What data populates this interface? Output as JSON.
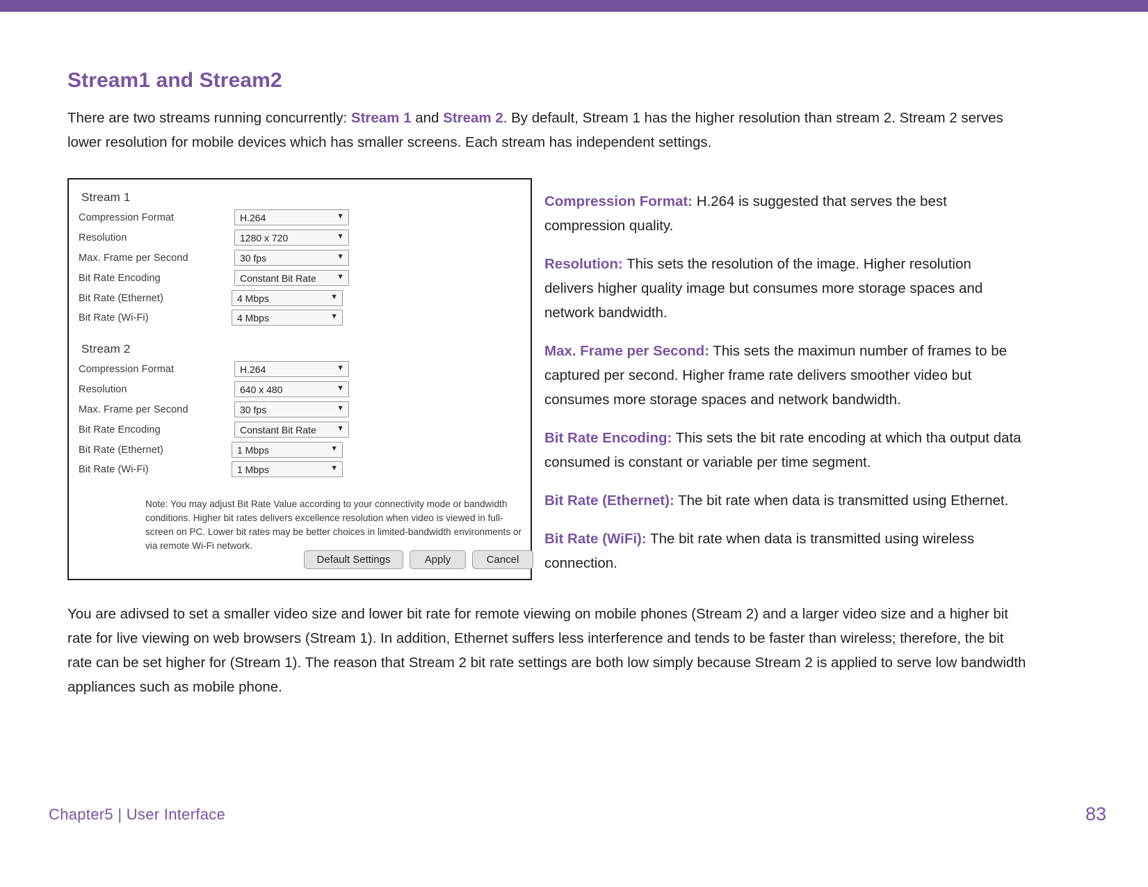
{
  "theme": {
    "accent": "#7a54a0",
    "top_bar": "#74529b",
    "body_text": "#231f20"
  },
  "section": {
    "title": "Stream1 and Stream2",
    "intro_part1": "There are two streams running concurrently: ",
    "intro_accent1": "Stream 1",
    "intro_part2": " and ",
    "intro_accent2": "Stream 2",
    "intro_part3": ". By default, Stream 1 has the higher resolution than stream 2. Stream 2 serves lower resolution for mobile devices which has smaller screens. Each stream has independent settings."
  },
  "settings_panel": {
    "stream1": {
      "heading": "Stream 1",
      "rows": [
        {
          "label": "Compression Format",
          "value": "H.264"
        },
        {
          "label": "Resolution",
          "value": "1280 x 720"
        },
        {
          "label": "Max. Frame per Second",
          "value": "30 fps"
        },
        {
          "label": "Bit Rate Encoding",
          "value": "Constant Bit Rate"
        },
        {
          "label": "Bit Rate (Ethernet)",
          "value": "4 Mbps"
        },
        {
          "label": "Bit Rate (Wi-Fi)",
          "value": "4 Mbps"
        }
      ]
    },
    "stream2": {
      "heading": "Stream 2",
      "rows": [
        {
          "label": "Compression Format",
          "value": "H.264"
        },
        {
          "label": "Resolution",
          "value": "640 x 480"
        },
        {
          "label": "Max. Frame per Second",
          "value": "30 fps"
        },
        {
          "label": "Bit Rate Encoding",
          "value": "Constant Bit Rate"
        },
        {
          "label": "Bit Rate (Ethernet)",
          "value": "1 Mbps"
        },
        {
          "label": "Bit Rate (Wi-Fi)",
          "value": "1 Mbps"
        }
      ]
    },
    "note": "Note: You may adjust Bit Rate Value according to your connectivity mode or bandwidth conditions. Higher bit rates delivers excellence resolution when video is viewed in full-screen on PC. Lower bit rates may be better choices in limited-bandwidth environments or via remote Wi-Fi network.",
    "buttons": {
      "default_settings": "Default Settings",
      "apply": "Apply",
      "cancel": "Cancel"
    },
    "dropdown_arrow_glyph": "▼"
  },
  "definitions": [
    {
      "term": "Compression Format:",
      "text": " H.264 is suggested that serves the best compression quality."
    },
    {
      "term": "Resolution:",
      "text": " This sets the resolution of the image. Higher resolution delivers higher quality image but consumes more storage spaces and network bandwidth."
    },
    {
      "term": "Max. Frame per Second:",
      "text": " This sets the maximun number of frames to be captured per second. Higher frame rate delivers smoother video but consumes more storage spaces and network bandwidth."
    },
    {
      "term": "Bit Rate Encoding:",
      "text": " This sets the bit rate encoding at which tha output data consumed is constant or variable per time segment."
    },
    {
      "term": "Bit Rate (Ethernet):",
      "text": " The bit rate when data is transmitted using Ethernet."
    },
    {
      "term": "Bit Rate (WiFi):",
      "text": " The bit rate when data is transmitted using wireless connection."
    }
  ],
  "closing_paragraph": "You are adivsed to set a smaller video size and lower bit rate for remote viewing on mobile phones (Stream 2) and a larger video size and a higher bit rate for live viewing on web browsers (Stream 1). In addition, Ethernet suffers less interference and tends to be faster than wireless; therefore, the bit rate can be set higher for (Stream 1). The reason that Stream 2 bit rate settings are both low simply because Stream 2 is applied to serve low bandwidth appliances such as mobile phone.",
  "footer": {
    "chapter": "Chapter5  |  User Interface",
    "page_number": "83"
  }
}
